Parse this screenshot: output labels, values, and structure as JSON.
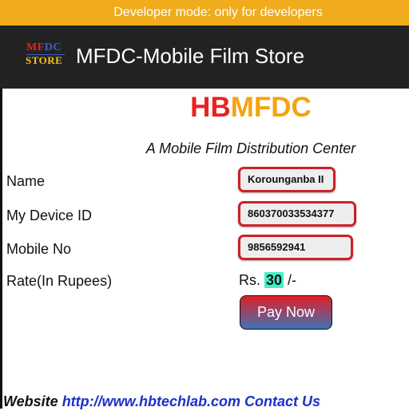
{
  "dev_banner": "Developer mode: only for developers",
  "appbar": {
    "logo": {
      "line1_red": "MF",
      "line1_blue": "DC",
      "line2": "STORE"
    },
    "title": "MFDC-Mobile Film Store"
  },
  "brand": {
    "hb": "HB",
    "mfdc": "MFDC"
  },
  "tagline": "A Mobile Film Distribution Center",
  "form": {
    "name": {
      "label": "Name",
      "value": "Korounganba II"
    },
    "device_id": {
      "label": "My Device ID",
      "value": "860370033534377"
    },
    "mobile": {
      "label": "Mobile No",
      "value": "9856592941"
    },
    "rate": {
      "label": "Rate(In Rupees)",
      "prefix": "Rs. ",
      "amount": "30",
      "suffix": " /-"
    }
  },
  "pay_button": "Pay Now",
  "footer": {
    "website_label": "Website ",
    "url": "http://www.hbtechlab.com",
    "contact": " Contact Us"
  },
  "colors": {
    "banner": "#f0ac1c",
    "appbar": "#222222",
    "brand_red": "#e8231f",
    "brand_orange": "#f4a40f",
    "field_border": "#cc2128",
    "amount_highlight": "#3ff2c8",
    "link": "#1b31c8"
  }
}
